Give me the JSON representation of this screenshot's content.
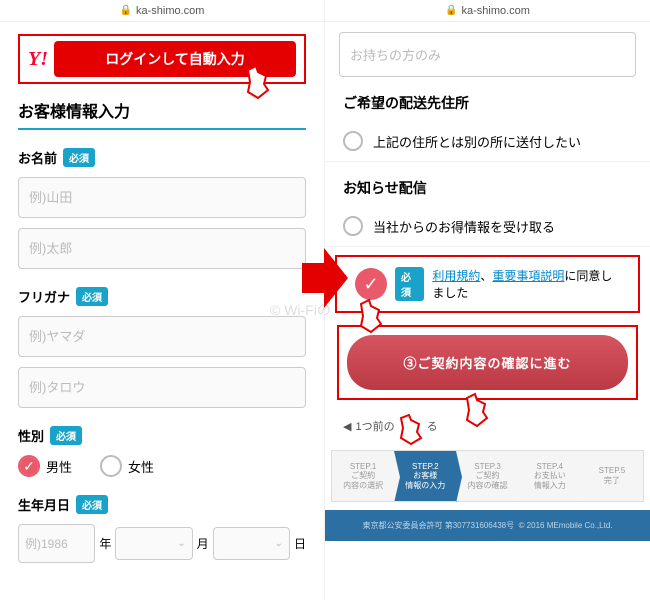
{
  "url": "ka-shimo.com",
  "left": {
    "yahoo_logo": "Y!",
    "yahoo_btn": "ログインして自動入力",
    "section": "お客様情報入力",
    "req": "必須",
    "name_label": "お名前",
    "name_ph1": "例)山田",
    "name_ph2": "例)太郎",
    "kana_label": "フリガナ",
    "kana_ph1": "例)ヤマダ",
    "kana_ph2": "例)タロウ",
    "gender_label": "性別",
    "male": "男性",
    "female": "女性",
    "dob_label": "生年月日",
    "dob_year_ph": "例)1986",
    "y": "年",
    "m": "月",
    "d": "日"
  },
  "right": {
    "own_ph": "お持ちの方のみ",
    "deliver_label": "ご希望の配送先住所",
    "deliver_opt": "上記の住所とは別の所に送付したい",
    "news_label": "お知らせ配信",
    "news_opt": "当社からのお得情報を受け取る",
    "req": "必須",
    "terms1": "利用規約",
    "sep": "、",
    "terms2": "重要事項説明",
    "terms_tail": "に同意しました",
    "proceed": "③ご契約内容の確認に進む",
    "back": "1つ前の",
    "back2": "る",
    "steps": [
      {
        "n": "STEP.1",
        "t1": "ご契約",
        "t2": "内容の選択"
      },
      {
        "n": "STEP.2",
        "t1": "お客様",
        "t2": "情報の入力"
      },
      {
        "n": "STEP.3",
        "t1": "ご契約",
        "t2": "内容の確認"
      },
      {
        "n": "STEP.4",
        "t1": "お支払い",
        "t2": "情報入力"
      },
      {
        "n": "STEP.5",
        "t1": "完了",
        "t2": ""
      }
    ],
    "footer1": "東京都公安委員会許可 第307731606438号",
    "footer2": "© 2016 MEmobile Co.,Ltd."
  },
  "watermark": "© Wi-Fiの"
}
